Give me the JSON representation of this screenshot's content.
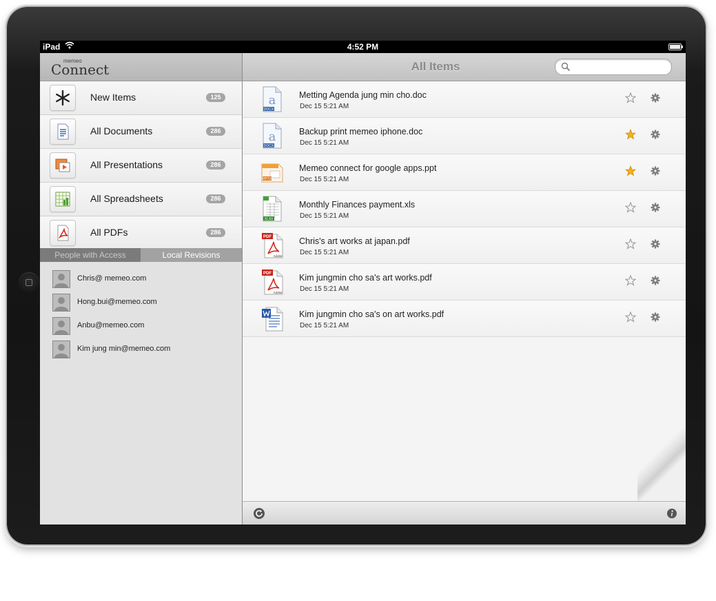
{
  "status_bar": {
    "carrier": "iPad",
    "time": "4:52 PM"
  },
  "sidebar": {
    "logo": {
      "brand": "Connect",
      "small": "memeo"
    },
    "categories": [
      {
        "label": "New Items",
        "count": "125",
        "icon": "asterisk-icon"
      },
      {
        "label": "All Documents",
        "count": "286",
        "icon": "document-icon"
      },
      {
        "label": "All Presentations",
        "count": "286",
        "icon": "presentation-icon"
      },
      {
        "label": "All Spreadsheets",
        "count": "286",
        "icon": "spreadsheet-icon"
      },
      {
        "label": "All PDFs",
        "count": "286",
        "icon": "pdf-icon"
      }
    ],
    "tabs": [
      {
        "label": "People with Access"
      },
      {
        "label": "Local Revisions"
      }
    ],
    "people": [
      {
        "email": "Chris@ memeo.com"
      },
      {
        "email": "Hong.bui@memeo.com"
      },
      {
        "email": "Anbu@memeo.com"
      },
      {
        "email": "Kim jung min@memeo.com"
      }
    ]
  },
  "main": {
    "title": "All Items",
    "search": {
      "placeholder": ""
    },
    "files": [
      {
        "name": "Metting Agenda jung min cho.doc",
        "date": "Dec 15  5:21 AM",
        "type": "docx",
        "starred": false
      },
      {
        "name": "Backup print memeo iphone.doc",
        "date": "Dec 15  5:21 AM",
        "type": "docx",
        "starred": true
      },
      {
        "name": "Memeo connect for google apps.ppt",
        "date": "Dec 15  5:21 AM",
        "type": "pptx",
        "starred": true
      },
      {
        "name": "Monthly Finances payment.xls",
        "date": "Dec 15  5:21 AM",
        "type": "xlsx",
        "starred": false
      },
      {
        "name": "Chris's art works at japan.pdf",
        "date": "Dec 15  5:21 AM",
        "type": "pdf",
        "starred": false
      },
      {
        "name": "Kim jungmin cho sa's art works.pdf",
        "date": "Dec 15  5:21 AM",
        "type": "pdf",
        "starred": false
      },
      {
        "name": "Kim jungmin cho sa's  on art works.pdf",
        "date": "Dec 15  5:21 AM",
        "type": "word",
        "starred": false
      }
    ]
  },
  "colors": {
    "star_active": "#f2b01e",
    "star_inactive": "#9a9a9a",
    "badge": "#a5a5a5"
  },
  "icon_labels": {
    "docx": "DOCX",
    "pptx": "PPTX",
    "xlsx": "XLSX",
    "pdf": "PDF",
    "pdf_brand": "Adobe"
  }
}
